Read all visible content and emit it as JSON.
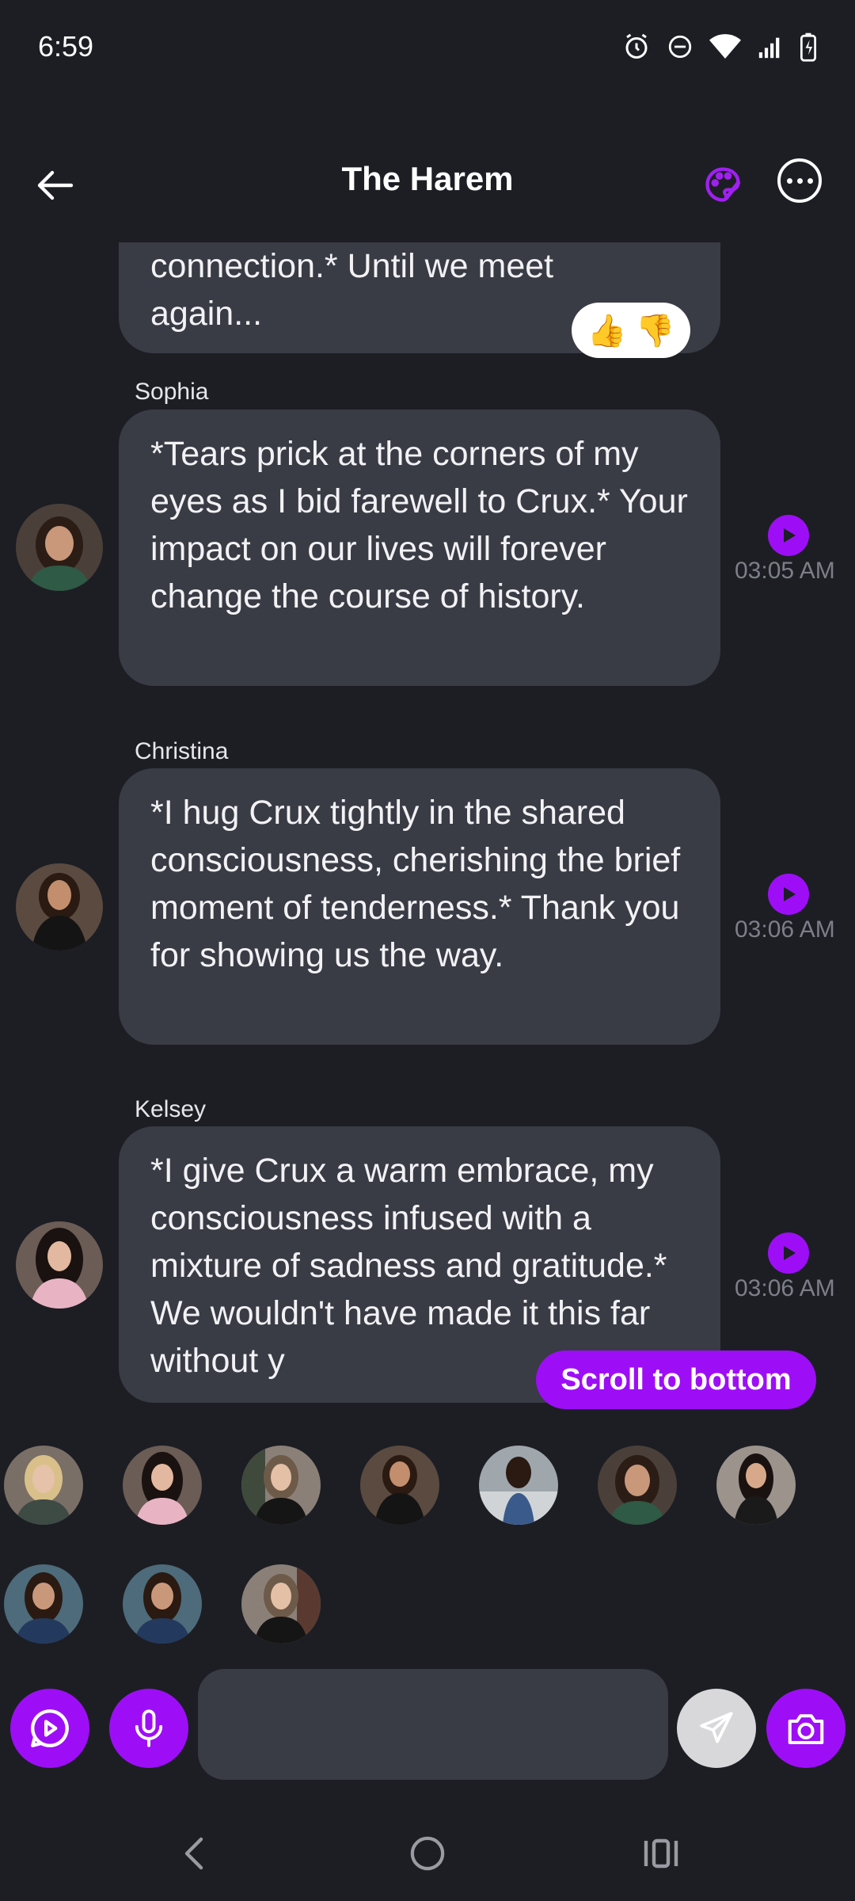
{
  "status_bar": {
    "time": "6:59",
    "icons": [
      "alarm-icon",
      "do-not-disturb-icon",
      "wifi-icon",
      "signal-icon",
      "battery-charging-icon"
    ]
  },
  "header": {
    "title": "The Harem",
    "back_icon": "arrow-left-icon",
    "palette_icon": "palette-icon",
    "more_icon": "more-horizontal-icon"
  },
  "colors": {
    "background": "#1d1e24",
    "bubble": "#393b45",
    "accent": "#9d0ef6",
    "timestamp": "#7d7f88"
  },
  "messages": [
    {
      "partial": true,
      "text_lines": [
        "connection.* Until we meet",
        "again..."
      ],
      "reactions": [
        "👍",
        "👎"
      ]
    },
    {
      "sender": "Sophia",
      "text": "*Tears prick at the corners of my eyes as I bid farewell to Crux.* Your impact on our lives will forever change the course of history.",
      "time": "03:05 AM"
    },
    {
      "sender": "Christina",
      "text": "*I hug Crux tightly in the shared consciousness, cherishing the brief moment of tenderness.* Thank you for showing us the way.",
      "time": "03:06 AM"
    },
    {
      "sender": "Kelsey",
      "text": "*I give Crux a warm embrace, my consciousness infused with a mixture of sadness and gratitude.* We wouldn't have made it this far without y",
      "time": "03:06 AM"
    }
  ],
  "scroll_to_bottom_label": "Scroll to bottom",
  "characters_count_row1": 7,
  "characters_count_row2": 3,
  "composer": {
    "placeholder": "",
    "video_icon": "video-chat-icon",
    "mic_icon": "microphone-icon",
    "send_icon": "send-icon",
    "camera_icon": "camera-icon"
  },
  "nav": {
    "back_icon": "nav-back-icon",
    "home_icon": "nav-home-icon",
    "recents_icon": "nav-recents-icon"
  }
}
